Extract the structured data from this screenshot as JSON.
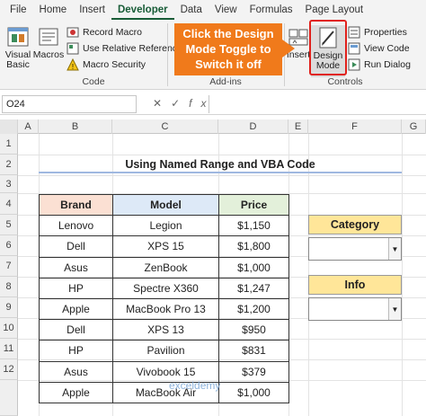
{
  "tabs": [
    "File",
    "Home",
    "Insert",
    "Developer",
    "Data",
    "View",
    "Formulas",
    "Page Layout"
  ],
  "ribbon": {
    "code": {
      "visual_basic": "Visual\nBasic",
      "macros": "Macros",
      "record_macro": "Record Macro",
      "relative_refs": "Use Relative References",
      "macro_security": "Macro Security",
      "label": "Code"
    },
    "addins": {
      "label": "Add-ins"
    },
    "controls": {
      "insert": "Insert",
      "design_mode": "Design\nMode",
      "properties": "Properties",
      "view_code": "View Code",
      "run_dialog": "Run Dialog",
      "label": "Controls"
    },
    "callout": "Click the Design Mode Toggle to Switch it off"
  },
  "formula_bar": {
    "name_box": "O24",
    "fx": "fx",
    "cancel": "✕",
    "enter": "✓",
    "value": ""
  },
  "columns": [
    "A",
    "B",
    "C",
    "D",
    "E",
    "F",
    "G"
  ],
  "rows": [
    "1",
    "2",
    "3",
    "4",
    "5",
    "6",
    "7",
    "8",
    "9",
    "10",
    "11",
    "12"
  ],
  "sheet": {
    "title": "Using Named Range and VBA Code",
    "headers": {
      "brand": "Brand",
      "model": "Model",
      "price": "Price"
    },
    "data": [
      {
        "brand": "Lenovo",
        "model": "Legion",
        "price": "$1,150"
      },
      {
        "brand": "Dell",
        "model": "XPS 15",
        "price": "$1,800"
      },
      {
        "brand": "Asus",
        "model": "ZenBook",
        "price": "$1,000"
      },
      {
        "brand": "HP",
        "model": "Spectre X360",
        "price": "$1,247"
      },
      {
        "brand": "Apple",
        "model": "MacBook Pro 13",
        "price": "$1,200"
      },
      {
        "brand": "Dell",
        "model": "XPS 13",
        "price": "$950"
      },
      {
        "brand": "HP",
        "model": "Pavilion",
        "price": "$831"
      },
      {
        "brand": "Asus",
        "model": "Vivobook 15",
        "price": "$379"
      },
      {
        "brand": "Apple",
        "model": "MacBook Air",
        "price": "$1,000"
      }
    ],
    "category_label": "Category",
    "info_label": "Info"
  },
  "watermark": "exceldemy",
  "colors": {
    "accent": "#185c37",
    "callout": "#f07a1b",
    "highlight": "#e0201b"
  }
}
